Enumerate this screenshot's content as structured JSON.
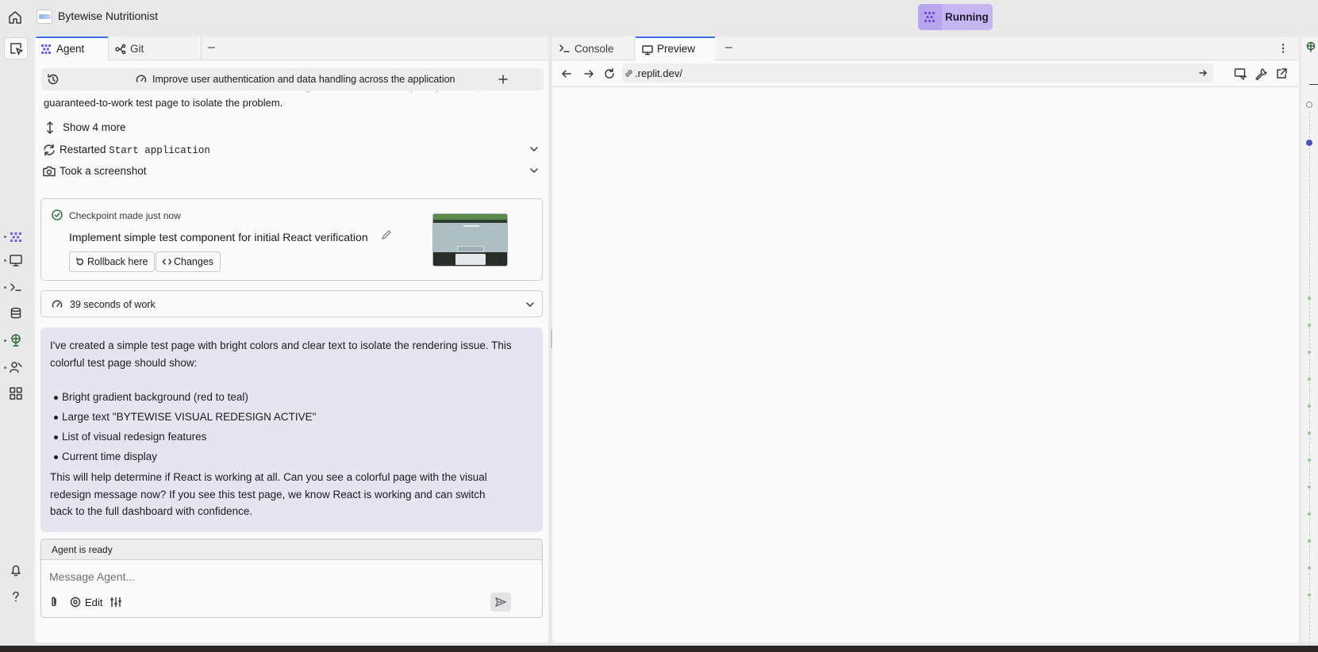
{
  "header": {
    "app_title": "Bytewise Nutritionist",
    "run_label": "Running",
    "accent_color": "#c6b7f3"
  },
  "agent_panel": {
    "tabs": [
      {
        "label": "Agent",
        "icon": "agent-logo-icon"
      },
      {
        "label": "Git",
        "icon": "git-branch-icon"
      }
    ],
    "minimize_label": "–",
    "task_title": "Improve user authentication and data handling across the application",
    "faded_line": "indicates there's a fundamental issue with React rendering. Let me create a completely minimal,",
    "continued_line": "guaranteed-to-work test page to isolate the problem.",
    "show_more_label": "Show 4 more",
    "restarted_prefix": "Restarted",
    "restarted_target": "Start application",
    "screenshot_label": "Took a screenshot",
    "checkpoint": {
      "made_prefix": "Checkpoint made",
      "made_time": "just now",
      "title": "Implement simple test component for initial React verification",
      "rollback_label": "Rollback here",
      "changes_label": "Changes"
    },
    "work_label": "39 seconds of work",
    "message": {
      "intro": "I've created a simple test page with bright colors and clear text to isolate the rendering issue. This colorful test page should show:",
      "items": [
        "Bright gradient background (red to teal)",
        "Large text \"BYTEWISE VISUAL REDESIGN ACTIVE\"",
        "List of visual redesign features",
        "Current time display"
      ],
      "outro": "This will help determine if React is working at all. Can you see a colorful page with the visual redesign message now? If you see this test page, we know React is working and can switch back to the full dashboard with confidence."
    },
    "input": {
      "status": "Agent is ready",
      "placeholder": "Message Agent...",
      "edit_label": "Edit"
    }
  },
  "preview_panel": {
    "tabs": [
      {
        "label": "Console",
        "icon": "terminal-icon"
      },
      {
        "label": "Preview",
        "icon": "monitor-icon"
      }
    ],
    "minimize_label": "–",
    "url": ".replit.dev/"
  }
}
